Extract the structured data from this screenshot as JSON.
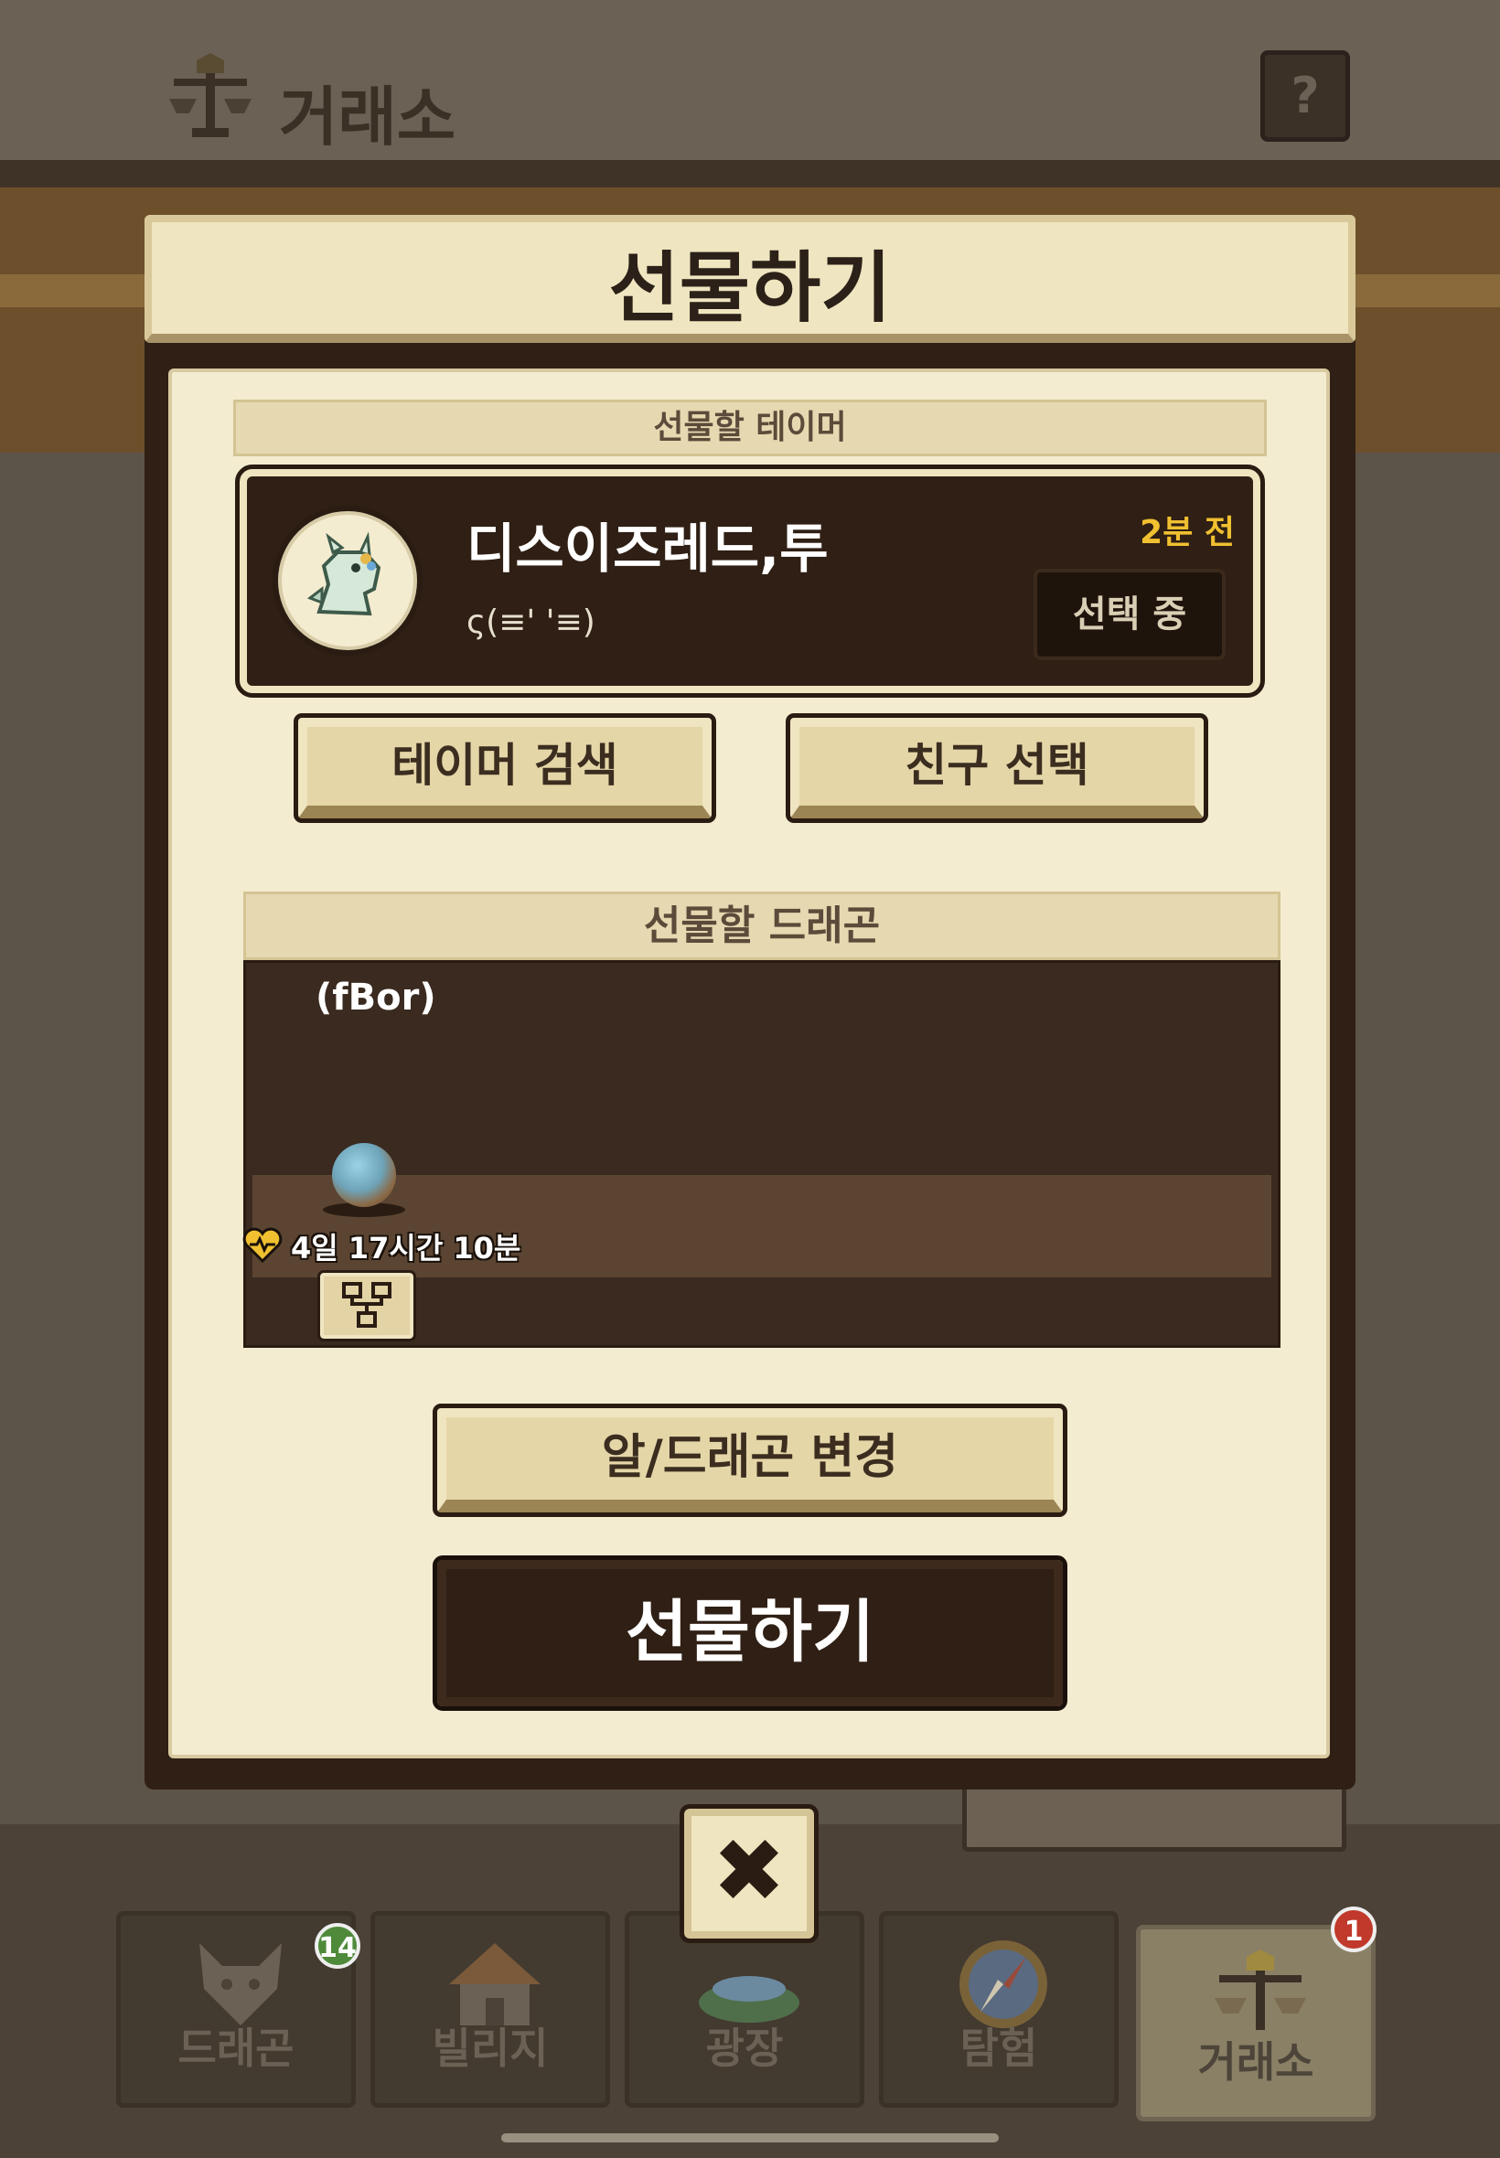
{
  "background": {
    "title": "거래소",
    "help_label": "?"
  },
  "modal": {
    "title": "선물하기",
    "tamer_section": {
      "label": "선물할 테이머",
      "tamer": {
        "name": "디스이즈레드,투",
        "message": "ς(≡' '≡)",
        "time": "2분 전",
        "status": "선택 중",
        "avatar_icon": "baby-dragon-avatar-icon"
      },
      "search_button": "테이머 검색",
      "friend_button": "친구 선택"
    },
    "dragon_section": {
      "label": "선물할 드래곤",
      "dragon_tag": "(fBor)",
      "timer": "4일 17시간 10분",
      "egg_icon": "egg-icon",
      "tree_icon": "family-tree-icon"
    },
    "change_button": "알/드래곤 변경",
    "gift_button": "선물하기",
    "close_icon": "close-icon"
  },
  "nav": {
    "items": [
      {
        "label": "드래곤",
        "badge": "14",
        "icon": "dragon-icon"
      },
      {
        "label": "빌리지",
        "badge": "",
        "icon": "village-icon"
      },
      {
        "label": "광장",
        "badge": "",
        "icon": "plaza-icon"
      },
      {
        "label": "탐험",
        "badge": "",
        "icon": "compass-icon"
      },
      {
        "label": "거래소",
        "badge": "1",
        "icon": "scale-icon"
      }
    ]
  },
  "colors": {
    "accent_gold": "#f0c030",
    "panel_cream": "#f4ecd0",
    "dark_brown": "#2f1f14",
    "badge_green": "#4f8a3a",
    "badge_red": "#c0392b"
  }
}
